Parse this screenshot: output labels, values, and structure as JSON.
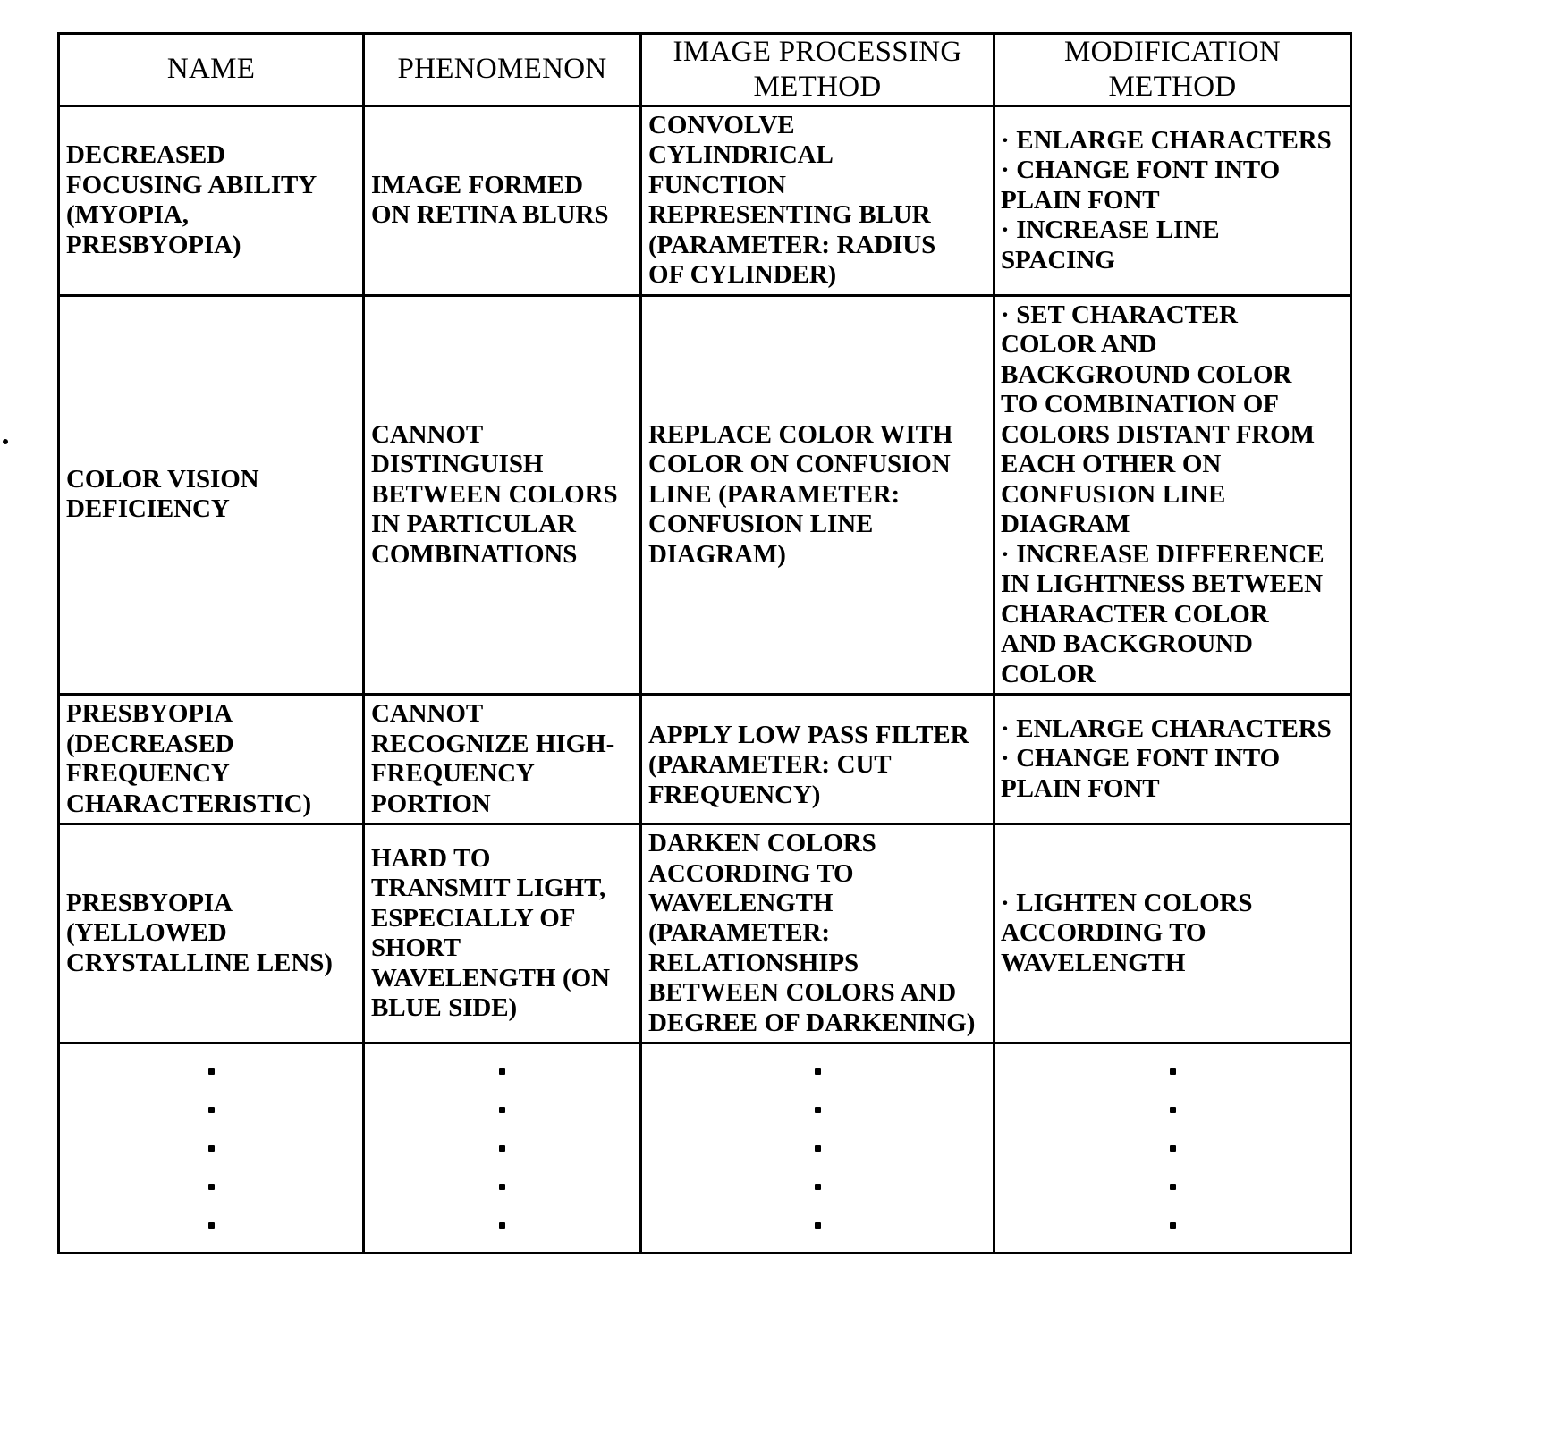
{
  "table": {
    "columns": [
      {
        "key": "name",
        "header": "NAME"
      },
      {
        "key": "phenomenon",
        "header": "PHENOMENON"
      },
      {
        "key": "image_processing",
        "header": "IMAGE PROCESSING\nMETHOD"
      },
      {
        "key": "modification",
        "header": "MODIFICATION\nMETHOD"
      }
    ],
    "rows": [
      {
        "name": "DECREASED\nFOCUSING ABILITY\n(MYOPIA,\nPRESBYOPIA)",
        "phenomenon": "IMAGE FORMED\nON RETINA BLURS",
        "image_processing": "CONVOLVE\nCYLINDRICAL\nFUNCTION\nREPRESENTING BLUR\n(PARAMETER: RADIUS\nOF CYLINDER)",
        "modification": "· ENLARGE CHARACTERS\n· CHANGE FONT INTO\nPLAIN FONT\n· INCREASE LINE\nSPACING"
      },
      {
        "name": "COLOR VISION\nDEFICIENCY",
        "phenomenon": "CANNOT\nDISTINGUISH\nBETWEEN COLORS\nIN PARTICULAR\nCOMBINATIONS",
        "image_processing": "REPLACE COLOR WITH\nCOLOR ON CONFUSION\nLINE (PARAMETER:\nCONFUSION LINE\nDIAGRAM)",
        "modification": "· SET CHARACTER\nCOLOR AND\nBACKGROUND COLOR\nTO COMBINATION OF\nCOLORS DISTANT FROM\nEACH OTHER ON\nCONFUSION LINE\nDIAGRAM\n· INCREASE DIFFERENCE\nIN LIGHTNESS BETWEEN\nCHARACTER COLOR\nAND BACKGROUND\nCOLOR"
      },
      {
        "name": "PRESBYOPIA\n(DECREASED\nFREQUENCY\nCHARACTERISTIC)",
        "phenomenon": "CANNOT\nRECOGNIZE HIGH-\nFREQUENCY\nPORTION",
        "image_processing": "APPLY LOW PASS FILTER\n(PARAMETER: CUT\nFREQUENCY)",
        "modification": "· ENLARGE CHARACTERS\n· CHANGE FONT INTO\nPLAIN FONT"
      },
      {
        "name": "PRESBYOPIA\n(YELLOWED\nCRYSTALLINE LENS)",
        "phenomenon": "HARD TO\nTRANSMIT LIGHT,\nESPECIALLY OF\nSHORT\nWAVELENGTH (ON\nBLUE SIDE)",
        "image_processing": "DARKEN COLORS\nACCORDING TO\nWAVELENGTH\n(PARAMETER:\nRELATIONSHIPS\nBETWEEN COLORS AND\nDEGREE OF DARKENING)",
        "modification": "· LIGHTEN COLORS\nACCORDING TO\nWAVELENGTH"
      }
    ],
    "continuation_row": {
      "marker": "vertical-ellipsis",
      "dots_per_cell": 5
    }
  },
  "style": {
    "border_color": "#000000",
    "text_color": "#000000",
    "background_color": "#ffffff"
  }
}
